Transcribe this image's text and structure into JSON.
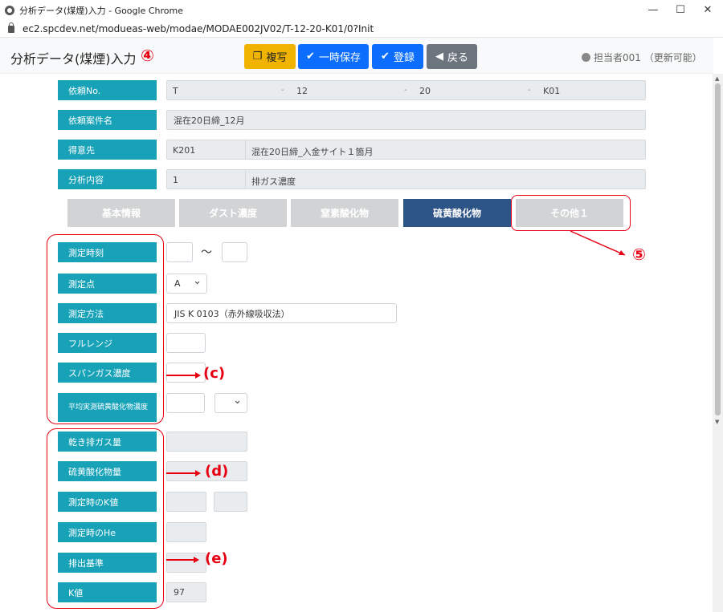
{
  "window": {
    "title": "分析データ(煤煙)入力 - Google Chrome",
    "url": "ec2.spcdev.net/modueas-web/modae/MODAE002JV02/T-12-20-K01/0?Init"
  },
  "header": {
    "page_title": "分析データ(煤煙)入力",
    "annotation": "④",
    "buttons": {
      "copy": "複写",
      "temp_save": "一時保存",
      "register": "登録",
      "back": "戻る"
    },
    "user": "担当者001 （更新可能）"
  },
  "request": {
    "no_label": "依頼No.",
    "no_parts": [
      "T",
      "12",
      "20",
      "K01"
    ],
    "separator": "-",
    "case_label": "依頼案件名",
    "case_value": "混在20日締_12月",
    "client_label": "得意先",
    "client_code": "K201",
    "client_name": "混在20日締_入金サイト１箇月",
    "analysis_label": "分析内容",
    "analysis_code": "1",
    "analysis_name": "排ガス濃度"
  },
  "tabs": [
    "基本情報",
    "ダスト濃度",
    "窒素酸化物",
    "硫黄酸化物",
    "その他１"
  ],
  "active_tab_index": 3,
  "form": {
    "time_label": "測定時刻",
    "time_sep": "～",
    "point_label": "測定点",
    "point_value": "A",
    "method_label": "測定方法",
    "method_value": "JIS K 0103（赤外線吸収法）",
    "fullrange_label": "フルレンジ",
    "span_label": "スパンガス濃度",
    "avg_label": "平均実測硫黄酸化物濃度",
    "dry_label": "乾き排ガス量",
    "sox_label": "硫黄酸化物量",
    "k_meas_label": "測定時のK値",
    "he_label": "測定時のHe",
    "std_label": "排出基準",
    "k_label": "K値",
    "k_value": "97"
  },
  "annotations": {
    "c": "(c)",
    "d": "(d)",
    "e": "(e)",
    "five": "⑤"
  },
  "colors": {
    "label_bg": "#17a2b8",
    "active_tab": "#2c5486",
    "annotation": "#e60012",
    "primary": "#0d6efd",
    "warning": "#f0b400"
  }
}
